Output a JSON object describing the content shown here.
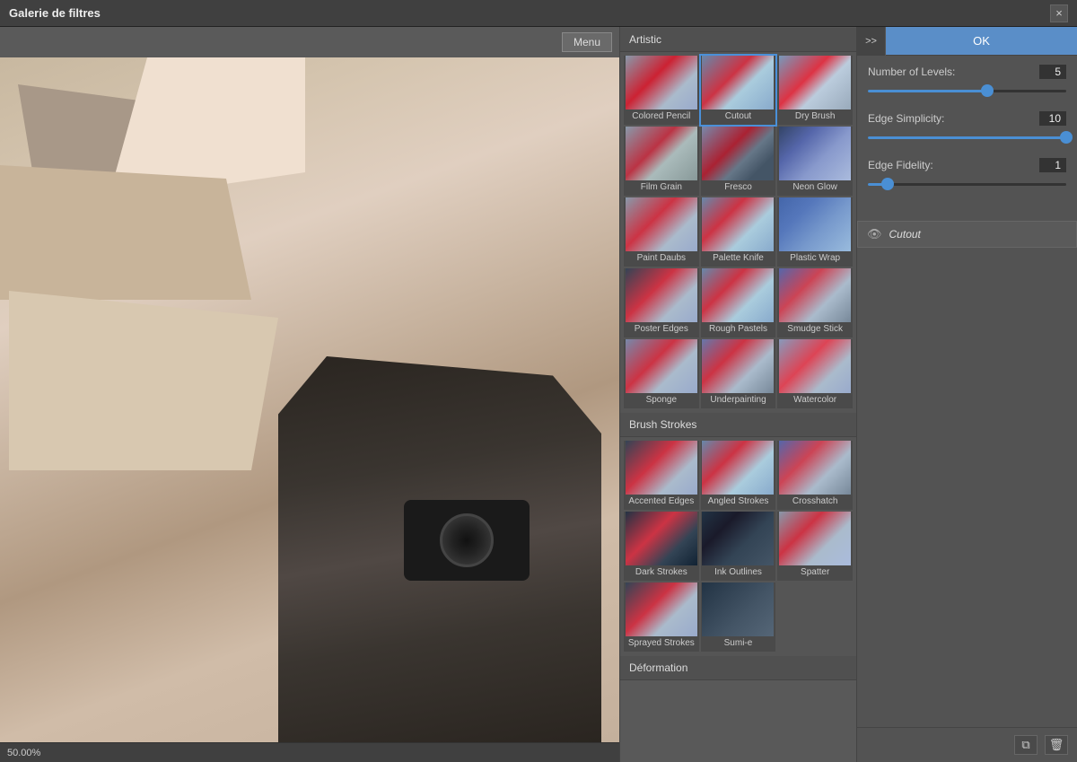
{
  "titleBar": {
    "title": "Galerie de filtres",
    "closeLabel": "×"
  },
  "toolbar": {
    "menuLabel": "Menu"
  },
  "filters": {
    "categories": [
      {
        "name": "Artistic",
        "items": [
          {
            "id": "colored-pencil",
            "label": "Colored Pencil",
            "thumbClass": "thumb-colored-pencil"
          },
          {
            "id": "cutout",
            "label": "Cutout",
            "thumbClass": "thumb-cutout",
            "active": true
          },
          {
            "id": "dry-brush",
            "label": "Dry Brush",
            "thumbClass": "thumb-dry-brush"
          },
          {
            "id": "film-grain",
            "label": "Film Grain",
            "thumbClass": "thumb-film-grain"
          },
          {
            "id": "fresco",
            "label": "Fresco",
            "thumbClass": "thumb-fresco"
          },
          {
            "id": "neon-glow",
            "label": "Neon Glow",
            "thumbClass": "thumb-neon-glow"
          },
          {
            "id": "paint-daubs",
            "label": "Paint Daubs",
            "thumbClass": "thumb-paint-daubs"
          },
          {
            "id": "palette-knife",
            "label": "Palette Knife",
            "thumbClass": "thumb-palette-knife"
          },
          {
            "id": "plastic-wrap",
            "label": "Plastic Wrap",
            "thumbClass": "thumb-plastic-wrap"
          },
          {
            "id": "poster-edges",
            "label": "Poster Edges",
            "thumbClass": "thumb-poster-edges"
          },
          {
            "id": "rough-pastels",
            "label": "Rough Pastels",
            "thumbClass": "thumb-rough-pastels"
          },
          {
            "id": "smudge-stick",
            "label": "Smudge Stick",
            "thumbClass": "thumb-smudge-stick"
          },
          {
            "id": "sponge",
            "label": "Sponge",
            "thumbClass": "thumb-sponge"
          },
          {
            "id": "underpainting",
            "label": "Underpainting",
            "thumbClass": "thumb-underpainting"
          },
          {
            "id": "watercolor",
            "label": "Watercolor",
            "thumbClass": "thumb-watercolor"
          }
        ]
      },
      {
        "name": "Brush Strokes",
        "items": [
          {
            "id": "accented-edges",
            "label": "Accented Edges",
            "thumbClass": "thumb-accented-edges"
          },
          {
            "id": "angled-strokes",
            "label": "Angled Strokes",
            "thumbClass": "thumb-angled-strokes"
          },
          {
            "id": "crosshatch",
            "label": "Crosshatch",
            "thumbClass": "thumb-crosshatch"
          },
          {
            "id": "dark-strokes",
            "label": "Dark Strokes",
            "thumbClass": "thumb-dark-strokes"
          },
          {
            "id": "ink-outlines",
            "label": "Ink Outlines",
            "thumbClass": "thumb-ink-outlines"
          },
          {
            "id": "spatter",
            "label": "Spatter",
            "thumbClass": "thumb-spatter"
          },
          {
            "id": "sprayed-strokes",
            "label": "Sprayed Strokes",
            "thumbClass": "thumb-sprayed-strokes"
          },
          {
            "id": "sumie",
            "label": "Sumi-e",
            "thumbClass": "thumb-sumie"
          }
        ]
      },
      {
        "name": "Déformation",
        "items": []
      }
    ]
  },
  "settings": {
    "expandLabel": ">>",
    "okLabel": "OK",
    "controls": [
      {
        "id": "number-of-levels",
        "label": "Number of Levels:",
        "value": 5,
        "min": 2,
        "max": 8,
        "fillPercent": 60
      },
      {
        "id": "edge-simplicity",
        "label": "Edge Simplicity:",
        "value": 10,
        "min": 0,
        "max": 10,
        "fillPercent": 100
      },
      {
        "id": "edge-fidelity",
        "label": "Edge Fidelity:",
        "value": 1,
        "min": 0,
        "max": 3,
        "fillPercent": 10
      }
    ],
    "activeFilter": "Cutout",
    "bottomIcons": [
      {
        "id": "copy-icon",
        "symbol": "⧉"
      },
      {
        "id": "delete-icon",
        "symbol": "🗑"
      }
    ]
  },
  "statusBar": {
    "zoom": "50.00%"
  }
}
